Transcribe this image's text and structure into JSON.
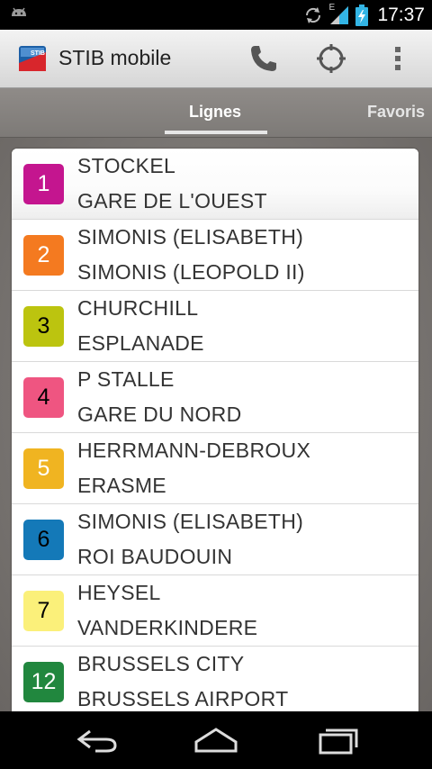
{
  "status_bar": {
    "time": "17:37",
    "network_type": "E",
    "icons": [
      "android-icon",
      "sync-icon",
      "signal-icon",
      "battery-charging-icon"
    ]
  },
  "action_bar": {
    "title": "STIB mobile",
    "logo_text": "STIB",
    "actions": [
      "phone-icon",
      "locate-icon",
      "overflow-menu-icon"
    ]
  },
  "tabs": [
    {
      "label": "Lignes",
      "selected": true
    },
    {
      "label": "Favoris",
      "selected": false
    }
  ],
  "lines": [
    {
      "number": "1",
      "color": "#c4158f",
      "text_color": "#ffffff",
      "from": "STOCKEL",
      "to": "GARE DE L'OUEST"
    },
    {
      "number": "2",
      "color": "#f47a20",
      "text_color": "#ffffff",
      "from": "SIMONIS (ELISABETH)",
      "to": "SIMONIS (LEOPOLD II)"
    },
    {
      "number": "3",
      "color": "#bcc40f",
      "text_color": "#000000",
      "from": "CHURCHILL",
      "to": "ESPLANADE"
    },
    {
      "number": "4",
      "color": "#ef5581",
      "text_color": "#000000",
      "from": "P STALLE",
      "to": "GARE DU NORD"
    },
    {
      "number": "5",
      "color": "#f0b421",
      "text_color": "#ffffff",
      "from": "HERRMANN-DEBROUX",
      "to": "ERASME"
    },
    {
      "number": "6",
      "color": "#1479b8",
      "text_color": "#000000",
      "from": "SIMONIS (ELISABETH)",
      "to": "ROI BAUDOUIN"
    },
    {
      "number": "7",
      "color": "#fbf07a",
      "text_color": "#000000",
      "from": "HEYSEL",
      "to": "VANDERKINDERE"
    },
    {
      "number": "12",
      "color": "#21873e",
      "text_color": "#ffffff",
      "from": "BRUSSELS CITY",
      "to": "BRUSSELS AIRPORT"
    }
  ],
  "nav_bar": [
    "back-icon",
    "home-icon",
    "recent-apps-icon"
  ]
}
